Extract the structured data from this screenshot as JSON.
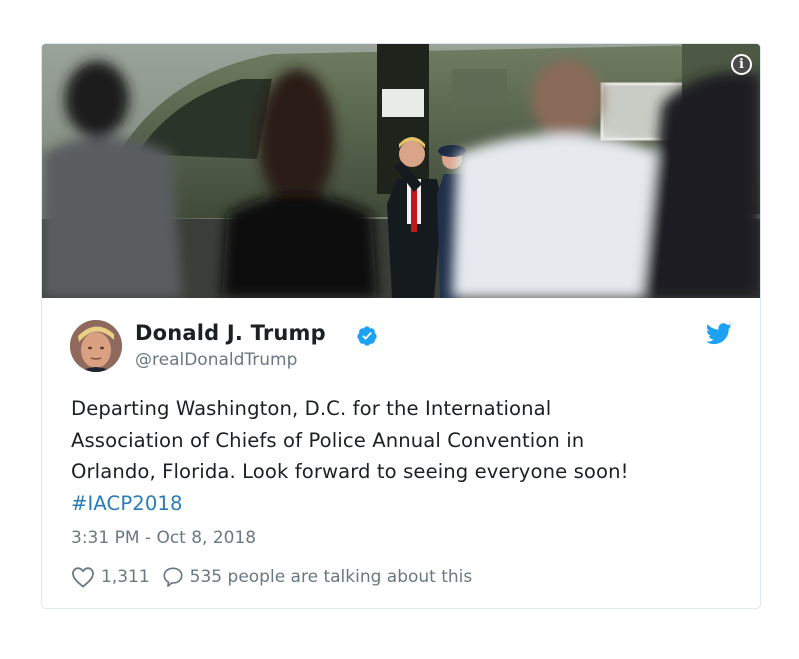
{
  "tweet": {
    "author_name": "Donald J. Trump",
    "author_handle": "@realDonaldTrump",
    "text_lines": [
      "Departing Washington, D.C. for the International",
      "Association of Chiefs of Police Annual Convention in",
      "Orlando, Florida. Look forward to seeing everyone soon!"
    ],
    "hashtag": "#IACP2018",
    "timestamp": "3:31 PM - Oct 8, 2018",
    "likes": "1,311",
    "talking": "535 people are talking about this"
  },
  "icons": {
    "info": "info-icon",
    "verified": "verified-badge-icon",
    "twitter": "twitter-bird-icon",
    "like": "heart-icon",
    "reply": "speech-bubble-icon"
  },
  "colors": {
    "link": "#2b7bb9",
    "secondary_text": "#697882",
    "twitter_blue": "#1da1f2",
    "border": "#e1e8ed"
  }
}
